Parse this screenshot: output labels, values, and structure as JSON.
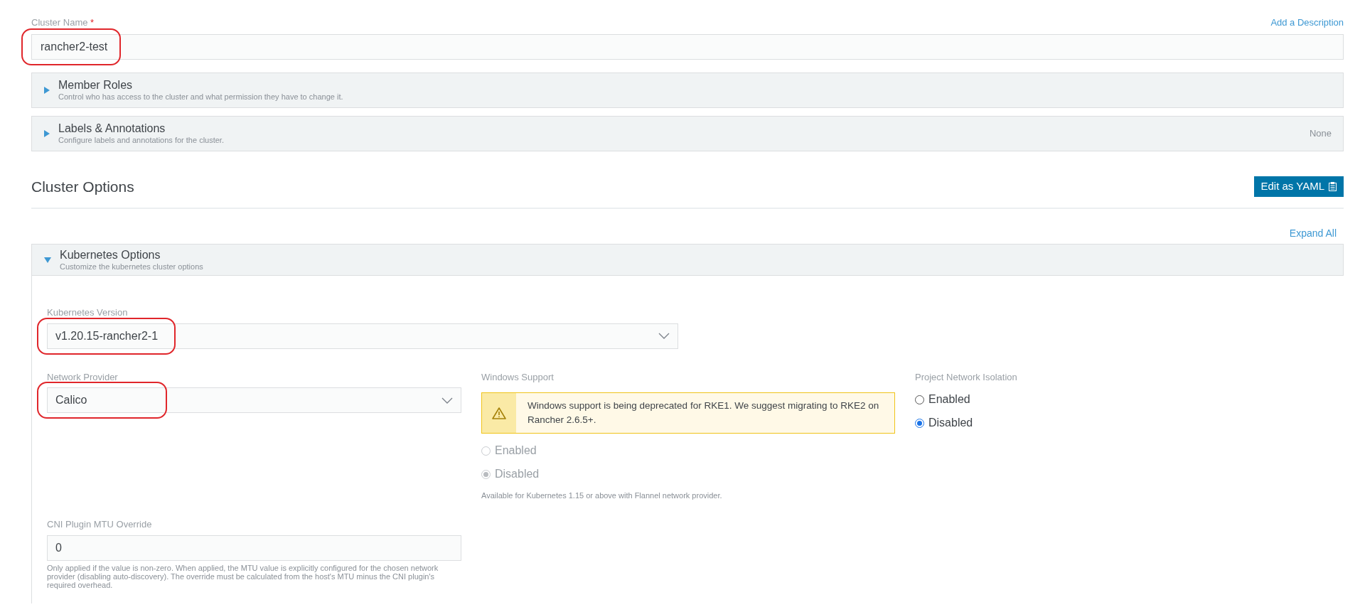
{
  "cluster_name": {
    "label": "Cluster Name",
    "required_mark": "*",
    "value": "rancher2-test",
    "annotated": true
  },
  "add_description_link": "Add a Description",
  "panels": [
    {
      "title": "Member Roles",
      "subtitle": "Control who has access to the cluster and what permission they have to change it.",
      "expanded": false
    },
    {
      "title": "Labels & Annotations",
      "subtitle": "Configure labels and annotations for the cluster.",
      "expanded": false,
      "status": "None"
    }
  ],
  "cluster_options": {
    "heading": "Cluster Options",
    "edit_yaml_button": "Edit as YAML",
    "expand_all_link": "Expand All"
  },
  "kubernetes_options": {
    "title": "Kubernetes Options",
    "subtitle": "Customize the kubernetes cluster options",
    "expanded": true,
    "kubernetes_version": {
      "label": "Kubernetes Version",
      "value": "v1.20.15-rancher2-1",
      "annotated": true
    },
    "network_provider": {
      "label": "Network Provider",
      "value": "Calico",
      "annotated": true
    },
    "windows_support": {
      "label": "Windows Support",
      "warning": "Windows support is being deprecated for RKE1. We suggest migrating to RKE2 on Rancher 2.6.5+.",
      "disabled": true,
      "options": [
        {
          "label": "Enabled",
          "selected": false
        },
        {
          "label": "Disabled",
          "selected": true
        }
      ],
      "help": "Available for Kubernetes 1.15 or above with Flannel network provider."
    },
    "project_network_isolation": {
      "label": "Project Network Isolation",
      "options": [
        {
          "label": "Enabled",
          "selected": false
        },
        {
          "label": "Disabled",
          "selected": true
        }
      ]
    },
    "cni_mtu": {
      "label": "CNI Plugin MTU Override",
      "value": "0",
      "help": "Only applied if the value is non-zero. When applied, the MTU value is explicitly configured for the chosen network provider (disabling auto-discovery). The override must be calculated from the host's MTU minus the CNI plugin's required overhead."
    }
  }
}
